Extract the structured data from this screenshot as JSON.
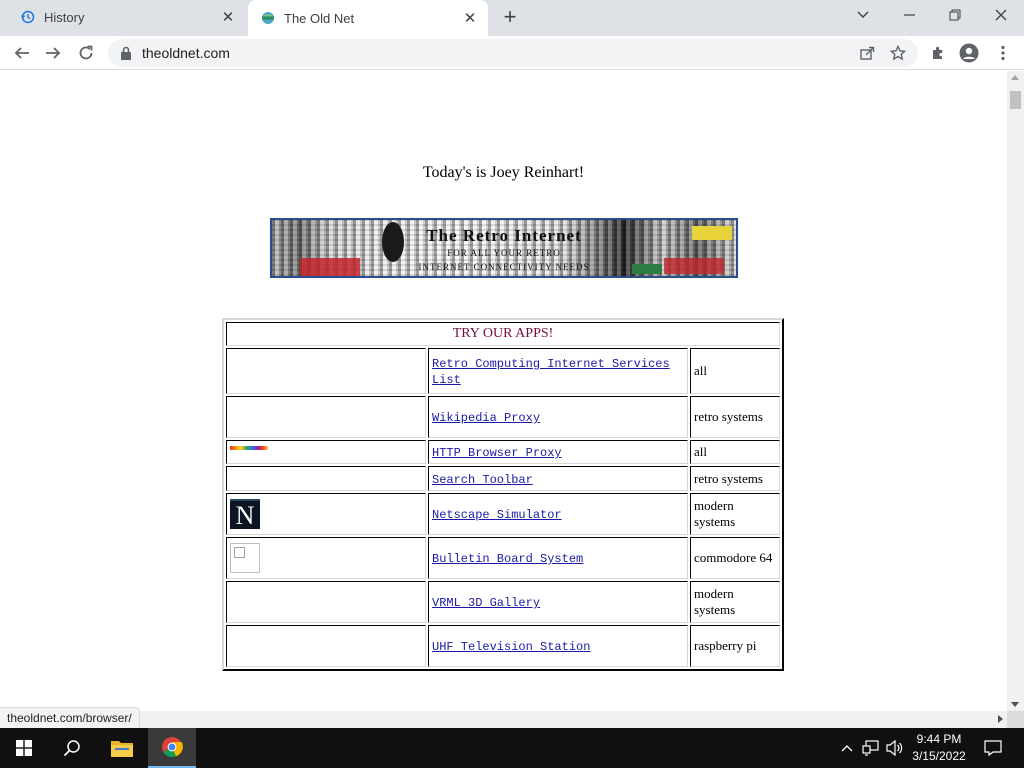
{
  "browser": {
    "tabs": [
      {
        "title": "History",
        "icon": "history-icon"
      },
      {
        "title": "The Old Net",
        "icon": "globe-icon"
      }
    ],
    "new_tab_symbol": "+",
    "url": "theoldnet.com",
    "status_url": "theoldnet.com/browser/"
  },
  "page": {
    "greeting": "Today's is Joey Reinhart!",
    "banner": {
      "line1": "The Retro Internet",
      "line2": "FOR ALL YOUR RETRO",
      "line3": "INTERNET CONNECTIVITY NEEDS"
    },
    "apps_header": "TRY OUR APPS!",
    "apps": [
      {
        "name": "Retro Computing Internet Services List",
        "platform": "all",
        "icon": "none"
      },
      {
        "name": "Wikipedia Proxy",
        "platform": "retro systems",
        "icon": "none"
      },
      {
        "name": "HTTP Browser Proxy",
        "platform": "all",
        "icon": "rainbow-strip"
      },
      {
        "name": "Search Toolbar",
        "platform": "retro systems",
        "icon": "none"
      },
      {
        "name": "Netscape Simulator",
        "platform": "modern systems",
        "icon": "netscape-logo",
        "icon_letter": "N"
      },
      {
        "name": "Bulletin Board System",
        "platform": "commodore 64",
        "icon": "broken-image"
      },
      {
        "name": "VRML 3D Gallery",
        "platform": "modern systems",
        "icon": "none"
      },
      {
        "name": "UHF Television Station",
        "platform": "raspberry pi",
        "icon": "none"
      }
    ]
  },
  "taskbar": {
    "time": "9:44 PM",
    "date": "3/15/2022"
  },
  "colors": {
    "header_text": "#7a0e3f",
    "link": "#1a1aa6",
    "tab_strip": "#dee1e6",
    "taskbar": "#101010"
  }
}
